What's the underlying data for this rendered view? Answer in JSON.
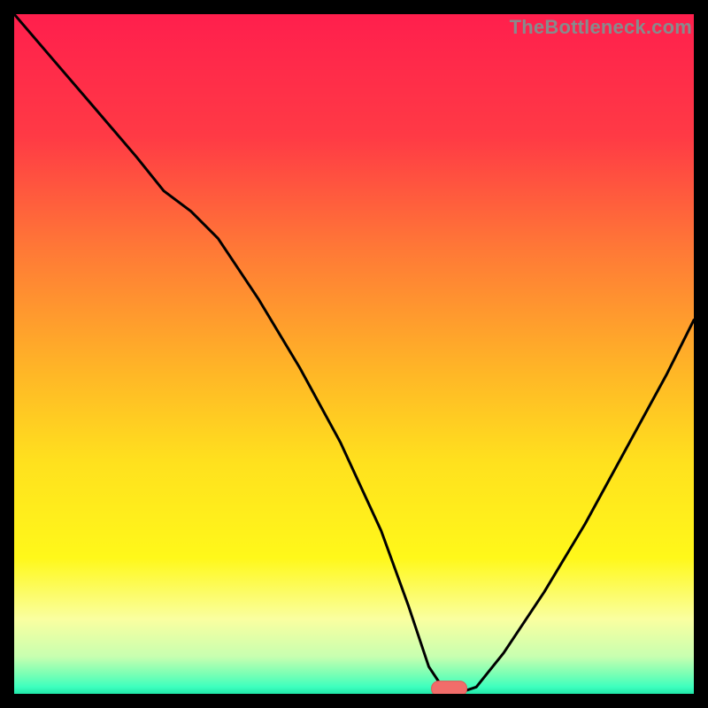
{
  "watermark": "TheBottleneck.com",
  "colors": {
    "bg": "#000000",
    "curve": "#000000",
    "marker_fill": "#f26d6a",
    "marker_stroke": "#e15a57",
    "gradient_stops": [
      {
        "offset": 0.0,
        "color": "#ff1f4d"
      },
      {
        "offset": 0.18,
        "color": "#ff3a45"
      },
      {
        "offset": 0.35,
        "color": "#ff7a36"
      },
      {
        "offset": 0.52,
        "color": "#ffb427"
      },
      {
        "offset": 0.66,
        "color": "#ffe11e"
      },
      {
        "offset": 0.8,
        "color": "#fff81a"
      },
      {
        "offset": 0.89,
        "color": "#faffa0"
      },
      {
        "offset": 0.945,
        "color": "#c8ffb0"
      },
      {
        "offset": 0.97,
        "color": "#7dffb4"
      },
      {
        "offset": 0.99,
        "color": "#3dffbe"
      },
      {
        "offset": 1.0,
        "color": "#20e6a8"
      }
    ]
  },
  "chart_data": {
    "type": "line",
    "title": "",
    "xlabel": "",
    "ylabel": "",
    "xlim": [
      0,
      100
    ],
    "ylim": [
      0,
      100
    ],
    "series": [
      {
        "name": "bottleneck-curve",
        "x": [
          0,
          6,
          12,
          18,
          22,
          26,
          30,
          36,
          42,
          48,
          54,
          58,
          61,
          63,
          65,
          68,
          72,
          78,
          84,
          90,
          96,
          100
        ],
        "y": [
          100,
          93,
          86,
          79,
          74,
          71,
          67,
          58,
          48,
          37,
          24,
          13,
          4,
          1,
          0,
          1,
          6,
          15,
          25,
          36,
          47,
          55
        ]
      }
    ],
    "marker": {
      "x": 64,
      "y": 0,
      "rx": 2.6,
      "ry": 1.1
    }
  }
}
